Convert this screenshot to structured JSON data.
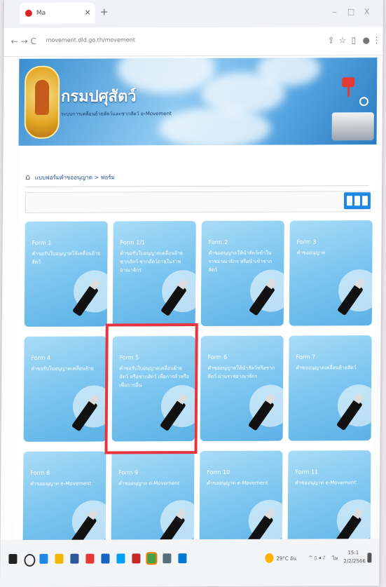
{
  "browser": {
    "tab_title": "Ma",
    "url": "movement.dld.go.th/movement",
    "new_tab": "+",
    "window_controls": [
      "‒",
      "□",
      "X"
    ],
    "nav": [
      "←",
      "→",
      "C"
    ]
  },
  "site": {
    "title": "กรมปศุสัตว์",
    "subtitle": "ระบบการเคลื่อนย้ายสัตว์และซากสัตว์ e-Movement"
  },
  "breadcrumb": {
    "path": "แบบฟอร์มคำขออนุญาต > ฟอร์ม"
  },
  "cards": [
    {
      "code": "Form 1",
      "desc": "คำขอรับใบอนุญาตให้เคลื่อนย้ายสัตว์"
    },
    {
      "code": "Form 1/1",
      "desc": "คำขอรับใบอนุญาตเคลื่อนย้ายซากสัตว์ ซากสัตว์ภายในราชอาณาจักร"
    },
    {
      "code": "Form 2",
      "desc": "คำขออนุญาตให้นำสัตว์เข้าในราชอาณาจักร หรือนำเข้าซากสัตว์"
    },
    {
      "code": "Form 3",
      "desc": "คำขออนุญาต"
    },
    {
      "code": "Form 4",
      "desc": "คำขอรับใบอนุญาตเคลื่อนย้าย"
    },
    {
      "code": "Form 5",
      "desc": "คำขอรับใบอนุญาตเคลื่อนย้ายสัตว์ หรือซากสัตว์ เพื่อการค้าหรือ เพื่อการอื่น"
    },
    {
      "code": "Form 6",
      "desc": "คำขออนุญาตให้นำสัตว์หรือซากสัตว์ ผ่านราชอาณาจักร"
    },
    {
      "code": "Form 7",
      "desc": "คำขออนุญาตเคลื่อนย้ายสัตว์"
    },
    {
      "code": "Form 8",
      "desc": "คำขออนุญาต e-Movement"
    },
    {
      "code": "Form 9",
      "desc": "คำขออนุญาต e-Movement"
    },
    {
      "code": "Form 10",
      "desc": "คำขออนุญาต e-Movement"
    },
    {
      "code": "Form 11",
      "desc": "คำขออนุญาต e-Movement"
    }
  ],
  "taskbar": {
    "weather": "29°C อัน",
    "time": "15:1",
    "date": "2/2/2566",
    "lang": "ไท"
  },
  "colors": {
    "accent": "#1e88e5",
    "highlight": "#e8343f",
    "card": "#78c3ef"
  }
}
